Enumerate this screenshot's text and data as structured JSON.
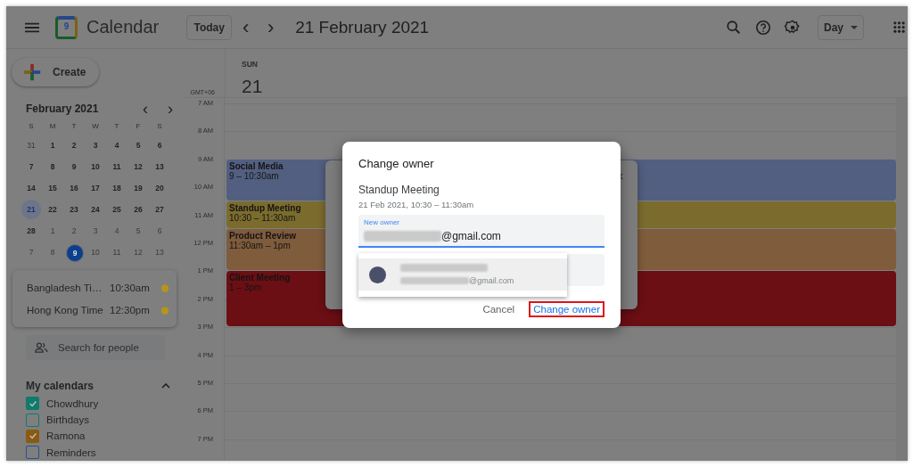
{
  "header": {
    "logo_day": "9",
    "app_name": "Calendar",
    "today_button": "Today",
    "prev": "‹",
    "next": "›",
    "date_title": "21 February 2021",
    "view_button": "Day"
  },
  "sidebar": {
    "create_button": "Create",
    "mini_calendar": {
      "title": "February 2021",
      "prev": "‹",
      "next": "›",
      "weekdays": [
        "S",
        "M",
        "T",
        "W",
        "T",
        "F",
        "S"
      ],
      "days": [
        {
          "d": "31",
          "muted": true,
          "selected": false,
          "today": false
        },
        {
          "d": "1",
          "muted": false,
          "selected": false,
          "today": false
        },
        {
          "d": "2",
          "muted": false,
          "selected": false,
          "today": false
        },
        {
          "d": "3",
          "muted": false,
          "selected": false,
          "today": false
        },
        {
          "d": "4",
          "muted": false,
          "selected": false,
          "today": false
        },
        {
          "d": "5",
          "muted": false,
          "selected": false,
          "today": false
        },
        {
          "d": "6",
          "muted": false,
          "selected": false,
          "today": false
        },
        {
          "d": "7",
          "muted": false,
          "selected": false,
          "today": false
        },
        {
          "d": "8",
          "muted": false,
          "selected": false,
          "today": false
        },
        {
          "d": "9",
          "muted": false,
          "selected": false,
          "today": false
        },
        {
          "d": "10",
          "muted": false,
          "selected": false,
          "today": false
        },
        {
          "d": "11",
          "muted": false,
          "selected": false,
          "today": false
        },
        {
          "d": "12",
          "muted": false,
          "selected": false,
          "today": false
        },
        {
          "d": "13",
          "muted": false,
          "selected": false,
          "today": false
        },
        {
          "d": "14",
          "muted": false,
          "selected": false,
          "today": false
        },
        {
          "d": "15",
          "muted": false,
          "selected": false,
          "today": false
        },
        {
          "d": "16",
          "muted": false,
          "selected": false,
          "today": false
        },
        {
          "d": "17",
          "muted": false,
          "selected": false,
          "today": false
        },
        {
          "d": "18",
          "muted": false,
          "selected": false,
          "today": false
        },
        {
          "d": "19",
          "muted": false,
          "selected": false,
          "today": false
        },
        {
          "d": "20",
          "muted": false,
          "selected": false,
          "today": false
        },
        {
          "d": "21",
          "muted": false,
          "selected": true,
          "today": false
        },
        {
          "d": "22",
          "muted": false,
          "selected": false,
          "today": false
        },
        {
          "d": "23",
          "muted": false,
          "selected": false,
          "today": false
        },
        {
          "d": "24",
          "muted": false,
          "selected": false,
          "today": false
        },
        {
          "d": "25",
          "muted": false,
          "selected": false,
          "today": false
        },
        {
          "d": "26",
          "muted": false,
          "selected": false,
          "today": false
        },
        {
          "d": "27",
          "muted": false,
          "selected": false,
          "today": false
        },
        {
          "d": "28",
          "muted": false,
          "selected": false,
          "today": false
        },
        {
          "d": "1",
          "muted": true,
          "selected": false,
          "today": false
        },
        {
          "d": "2",
          "muted": true,
          "selected": false,
          "today": false
        },
        {
          "d": "3",
          "muted": true,
          "selected": false,
          "today": false
        },
        {
          "d": "4",
          "muted": true,
          "selected": false,
          "today": false
        },
        {
          "d": "5",
          "muted": true,
          "selected": false,
          "today": false
        },
        {
          "d": "6",
          "muted": true,
          "selected": false,
          "today": false
        },
        {
          "d": "7",
          "muted": true,
          "selected": false,
          "today": false
        },
        {
          "d": "8",
          "muted": true,
          "selected": false,
          "today": false
        },
        {
          "d": "9",
          "muted": true,
          "selected": false,
          "today": true
        },
        {
          "d": "10",
          "muted": true,
          "selected": false,
          "today": false
        },
        {
          "d": "11",
          "muted": true,
          "selected": false,
          "today": false
        },
        {
          "d": "12",
          "muted": true,
          "selected": false,
          "today": false
        },
        {
          "d": "13",
          "muted": true,
          "selected": false,
          "today": false
        }
      ]
    },
    "time_zones": [
      {
        "name": "Bangladesh Ti…",
        "time": "10:30am"
      },
      {
        "name": "Hong Kong Time",
        "time": "12:30pm"
      }
    ],
    "search_people": {
      "placeholder": "Search for people"
    },
    "my_calendars": {
      "title": "My calendars",
      "expanded": true,
      "items": [
        {
          "name": "Chowdhury",
          "checked": true,
          "color": "#0f7a6e"
        },
        {
          "name": "Birthdays",
          "checked": false,
          "color": "#0f7a6e"
        },
        {
          "name": "Ramona",
          "checked": true,
          "color": "#8a5a10"
        },
        {
          "name": "Reminders",
          "checked": false,
          "color": "#2a4f8f"
        }
      ]
    }
  },
  "day_view": {
    "weekday": "SUN",
    "day": "21",
    "timezone": "GMT+06",
    "hours": [
      "7 AM",
      "8 AM",
      "9 AM",
      "10 AM",
      "11 AM",
      "12 PM",
      "1 PM",
      "2 PM",
      "3 PM",
      "4 PM",
      "5 PM",
      "6 PM",
      "7 PM"
    ],
    "events": [
      {
        "title": "Social Media",
        "time": "9 – 10:30am",
        "color": "#525f80"
      },
      {
        "title": "Standup Meeting",
        "time": "10:30 – 11:30am",
        "color": "#7b6c2e"
      },
      {
        "title": "Product Review",
        "time": "11:30am – 1pm",
        "color": "#7f5c3c"
      },
      {
        "title": "Client Meeting",
        "time": "1 – 3pm",
        "color": "#6b0f14"
      }
    ]
  },
  "dialog": {
    "title": "Change owner",
    "event_title": "Standup Meeting",
    "event_time": "21 Feb 2021, 10:30 – 11:30am",
    "field": {
      "label": "New owner",
      "value_suffix": "@gmail.com"
    },
    "suggestion": {
      "email_suffix": "@gmail.com"
    },
    "buttons": [
      {
        "label": "Cancel",
        "kind": "text"
      },
      {
        "label": "Change owner",
        "kind": "primary"
      }
    ]
  }
}
